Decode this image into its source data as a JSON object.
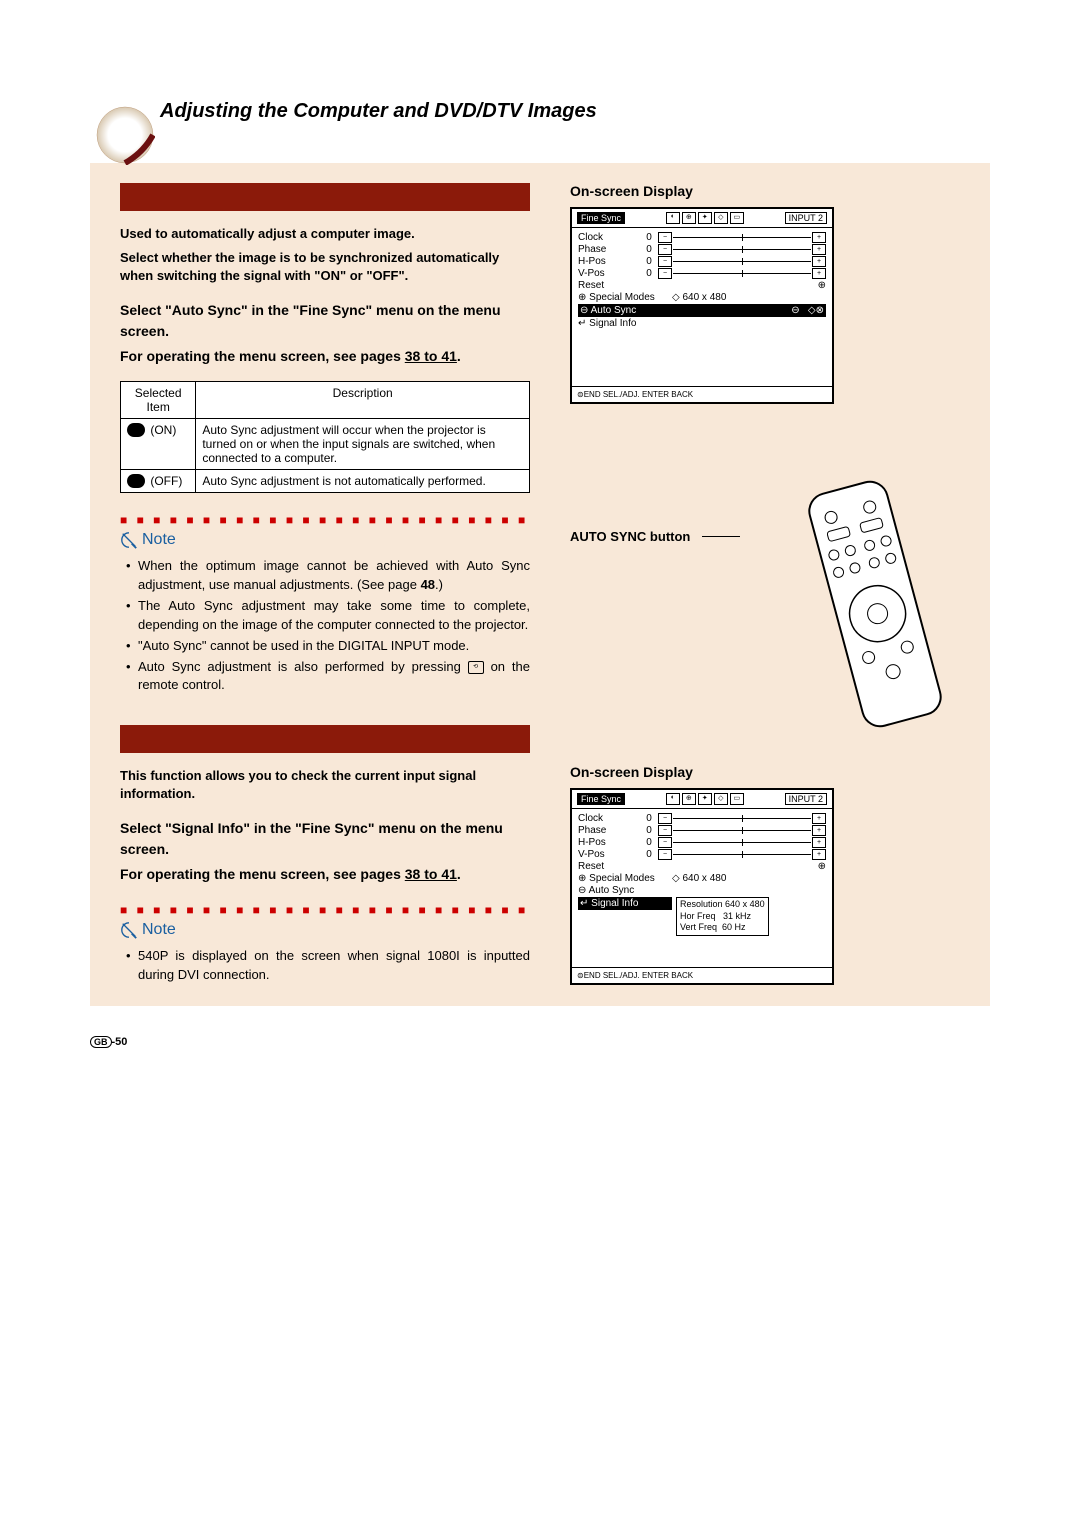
{
  "title": "Adjusting the Computer and DVD/DTV Images",
  "section1": {
    "intro": "Used to automatically adjust a computer image.",
    "sub": "Select whether the image is to be synchronized automatically when switching the signal with \"ON\" or \"OFF\".",
    "select_line": "Select \"Auto Sync\" in the \"Fine Sync\" menu on the menu screen.",
    "operate_prefix": "For operating the menu screen, see pages ",
    "operate_link": "38 to 41",
    "operate_suffix": ".",
    "table": {
      "h1": "Selected Item",
      "h2": "Description",
      "on_label": "(ON)",
      "on_desc": "Auto Sync adjustment will occur when the projector is turned on or when the input signals are switched, when connected to a computer.",
      "off_label": "(OFF)",
      "off_desc": "Auto Sync adjustment is not automatically performed."
    },
    "note_label": "Note",
    "note_b1a": "When the optimum image cannot be achieved with Auto Sync adjustment, use manual adjustments. (See page ",
    "note_b1_link": "48",
    "note_b1b": ".)",
    "note_b2": "The Auto Sync adjustment may take some time to complete, depending on the image of the computer connected to the projector.",
    "note_b3": "\"Auto Sync\" cannot be used in the DIGITAL INPUT mode.",
    "note_b4a": "Auto Sync adjustment is also performed by pressing ",
    "note_b4b": " on the remote control."
  },
  "section2": {
    "intro": "This function allows you to check the current input signal information.",
    "select_line": "Select \"Signal Info\" in the \"Fine Sync\" menu on the menu screen.",
    "operate_prefix": "For operating the menu screen, see pages ",
    "operate_link": "38 to 41",
    "operate_suffix": ".",
    "note_label": "Note",
    "note_b1": "540P is displayed on the screen when signal 1080I is inputted during DVI connection."
  },
  "osd1": {
    "heading": "On-screen Display",
    "tab": "Fine Sync",
    "input": "INPUT 2",
    "rows": [
      "Clock",
      "Phase",
      "H-Pos",
      "V-Pos"
    ],
    "reset": "Reset",
    "special": "Special Modes",
    "special_val": "640 x 480",
    "autosync": "Auto Sync",
    "signal": "Signal Info",
    "footer": "END      SEL./ADJ.    ENTER    BACK"
  },
  "osd2": {
    "heading": "On-screen Display",
    "tab": "Fine Sync",
    "input": "INPUT 2",
    "rows": [
      "Clock",
      "Phase",
      "H-Pos",
      "V-Pos"
    ],
    "reset": "Reset",
    "special": "Special Modes",
    "special_val": "640 x 480",
    "autosync": "Auto Sync",
    "signal": "Signal Info",
    "res_l": "Resolution",
    "res_v": "640 x 480",
    "hor_l": "Hor Freq",
    "hor_v": "31 kHz",
    "ver_l": "Vert Freq",
    "ver_v": "60 Hz",
    "footer": "END      SEL./ADJ.    ENTER    BACK"
  },
  "autosync_btn": "AUTO SYNC button",
  "page_num": "-50",
  "gb": "GB"
}
